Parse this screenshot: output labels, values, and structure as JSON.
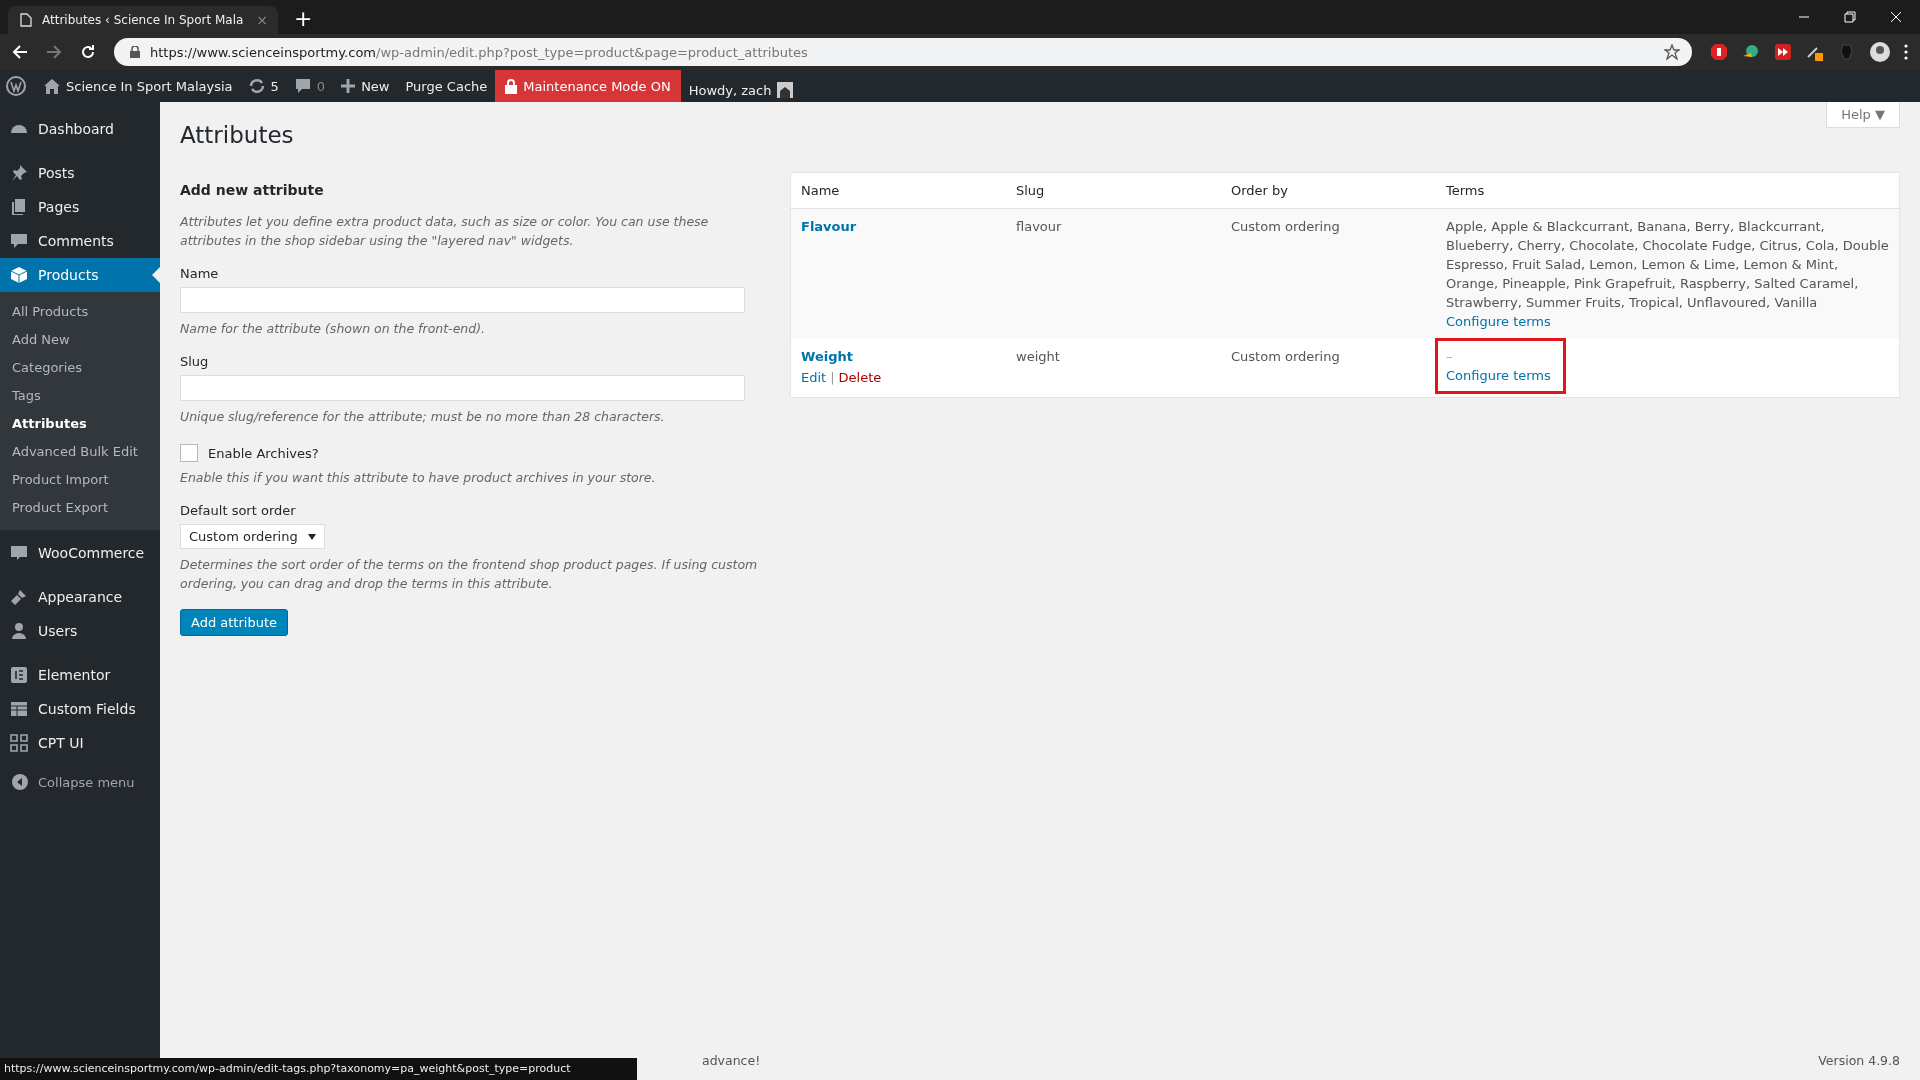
{
  "browser": {
    "tab_title": "Attributes ‹ Science In Sport Mala",
    "tab_close": "×",
    "new_tab": "+",
    "url_host": "https://www.scienceinsportmy.com",
    "url_path": "/wp-admin/edit.php?post_type=product&page=product_attributes"
  },
  "admin_bar": {
    "site": "Science In Sport Malaysia",
    "updates": "5",
    "comments": "0",
    "new": "New",
    "purge": "Purge Cache",
    "maintenance": "Maintenance Mode ON",
    "howdy": "Howdy, zach"
  },
  "help": "Help ▼",
  "sidebar": {
    "items": [
      {
        "label": "Dashboard",
        "selected": false
      },
      {
        "label": "Posts",
        "selected": false
      },
      {
        "label": "Pages",
        "selected": false
      },
      {
        "label": "Comments",
        "selected": false
      },
      {
        "label": "Products",
        "selected": true,
        "children": [
          {
            "label": "All Products",
            "selected": false
          },
          {
            "label": "Add New",
            "selected": false
          },
          {
            "label": "Categories",
            "selected": false
          },
          {
            "label": "Tags",
            "selected": false
          },
          {
            "label": "Attributes",
            "selected": true
          },
          {
            "label": "Advanced Bulk Edit",
            "selected": false
          },
          {
            "label": "Product Import",
            "selected": false
          },
          {
            "label": "Product Export",
            "selected": false
          }
        ]
      },
      {
        "label": "WooCommerce",
        "selected": false
      },
      {
        "label": "Appearance",
        "selected": false
      },
      {
        "label": "Users",
        "selected": false
      },
      {
        "label": "Elementor",
        "selected": false
      },
      {
        "label": "Custom Fields",
        "selected": false
      },
      {
        "label": "CPT UI",
        "selected": false
      }
    ],
    "collapse": "Collapse menu"
  },
  "page_title": "Attributes",
  "form": {
    "heading": "Add new attribute",
    "intro": "Attributes let you define extra product data, such as size or color. You can use these attributes in the shop sidebar using the \"layered nav\" widgets.",
    "name_label": "Name",
    "name_help": "Name for the attribute (shown on the front-end).",
    "slug_label": "Slug",
    "slug_help": "Unique slug/reference for the attribute; must be no more than 28 characters.",
    "archives_label": "Enable Archives?",
    "archives_checked": false,
    "archives_help": "Enable this if you want this attribute to have product archives in your store.",
    "sort_label": "Default sort order",
    "sort_value": "Custom ordering",
    "sort_help": "Determines the sort order of the terms on the frontend shop product pages. If using custom ordering, you can drag and drop the terms in this attribute.",
    "submit": "Add attribute"
  },
  "table": {
    "columns": [
      "Name",
      "Slug",
      "Order by",
      "Terms"
    ],
    "rows": [
      {
        "name": "Flavour",
        "slug": "flavour",
        "order_by": "Custom ordering",
        "terms": "Apple, Apple & Blackcurrant, Banana, Berry, Blackcurrant, Blueberry, Cherry, Chocolate, Chocolate Fudge, Citrus, Cola, Double Espresso, Fruit Salad, Lemon, Lemon & Lime, Lemon & Mint, Orange, Pineapple, Pink Grapefruit, Raspberry, Salted Caramel, Strawberry, Summer Fruits, Tropical, Unflavoured, Vanilla",
        "configure": "Configure terms",
        "highlighted": false
      },
      {
        "name": "Weight",
        "slug": "weight",
        "order_by": "Custom ordering",
        "terms": "–",
        "configure": "Configure terms",
        "edit": "Edit",
        "separator": "|",
        "delete": "Delete",
        "highlighted": true
      }
    ]
  },
  "footer": {
    "text": "advance!",
    "version": "Version 4.9.8"
  },
  "status_url": "https://www.scienceinsportmy.com/wp-admin/edit-tags.php?taxonomy=pa_weight&post_type=product"
}
